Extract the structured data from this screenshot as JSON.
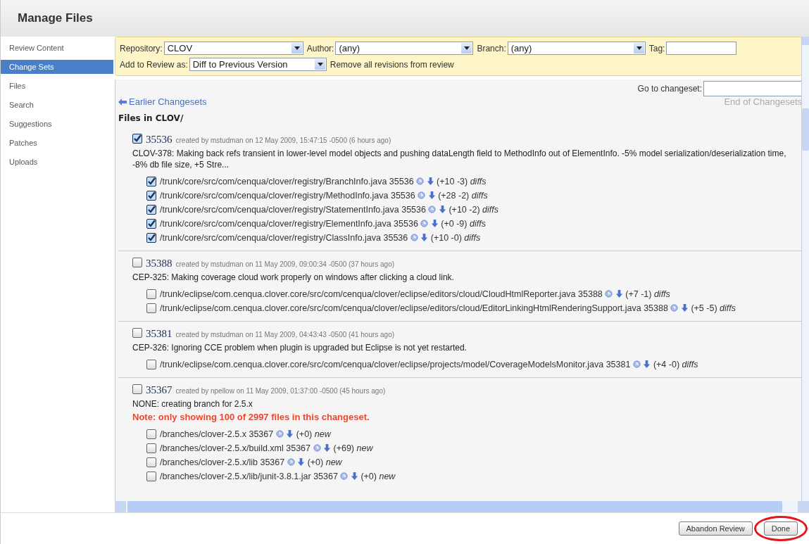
{
  "page": {
    "title": "Manage Files"
  },
  "sidebar": {
    "items": [
      {
        "label": "Review Content",
        "selected": false
      },
      {
        "label": "Change Sets",
        "selected": true
      },
      {
        "label": "Files",
        "selected": false
      },
      {
        "label": "Search",
        "selected": false
      },
      {
        "label": "Suggestions",
        "selected": false
      },
      {
        "label": "Patches",
        "selected": false
      },
      {
        "label": "Uploads",
        "selected": false
      }
    ]
  },
  "filters": {
    "repository_label": "Repository:",
    "repository": "CLOV",
    "author_label": "Author:",
    "author": "(any)",
    "branch_label": "Branch:",
    "branch": "(any)",
    "tag_label": "Tag:",
    "add_label": "Add to Review as:",
    "add_as": "Diff to Previous Version",
    "remove_link": "Remove all revisions from review"
  },
  "navigation": {
    "goto_label": "Go to changeset:",
    "earlier": "Earlier Changesets",
    "end": "End of Changesets"
  },
  "heading": "Files in CLOV/",
  "changesets": [
    {
      "checked": true,
      "revision": "35536",
      "meta": "created by mstudman on 12 May 2009, 15:47:15 -0500 (6 hours ago)",
      "description": "CLOV-378: Making back refs transient in lower-level model objects and pushing dataLength field to MethodInfo out of ElementInfo. -5% model serialization/deserialization time, -8% db file size, +5 Stre...",
      "files": [
        {
          "checked": true,
          "path": "/trunk/core/src/com/cenqua/clover/registry/BranchInfo.java",
          "revision": "35536",
          "changes": "(+10 -3)",
          "tag": "diffs"
        },
        {
          "checked": true,
          "path": "/trunk/core/src/com/cenqua/clover/registry/MethodInfo.java",
          "revision": "35536",
          "changes": "(+28 -2)",
          "tag": "diffs"
        },
        {
          "checked": true,
          "path": "/trunk/core/src/com/cenqua/clover/registry/StatementInfo.java",
          "revision": "35536",
          "changes": "(+10 -2)",
          "tag": "diffs"
        },
        {
          "checked": true,
          "path": "/trunk/core/src/com/cenqua/clover/registry/ElementInfo.java",
          "revision": "35536",
          "changes": "(+0 -9)",
          "tag": "diffs"
        },
        {
          "checked": true,
          "path": "/trunk/core/src/com/cenqua/clover/registry/ClassInfo.java",
          "revision": "35536",
          "changes": "(+10 -0)",
          "tag": "diffs"
        }
      ]
    },
    {
      "checked": false,
      "revision": "35388",
      "meta": "created by mstudman on 11 May 2009, 09:00:34 -0500 (37 hours ago)",
      "description": "CEP-325: Making coverage cloud work properly on windows after clicking a cloud link.",
      "files": [
        {
          "checked": false,
          "path": "/trunk/eclipse/com.cenqua.clover.core/src/com/cenqua/clover/eclipse/editors/cloud/CloudHtmlReporter.java",
          "revision": "35388",
          "changes": "(+7 -1)",
          "tag": "diffs"
        },
        {
          "checked": false,
          "path": "/trunk/eclipse/com.cenqua.clover.core/src/com/cenqua/clover/eclipse/editors/cloud/EditorLinkingHtmlRenderingSupport.java",
          "revision": "35388",
          "changes": "(+5 -5)",
          "tag": "diffs"
        }
      ]
    },
    {
      "checked": false,
      "revision": "35381",
      "meta": "created by mstudman on 11 May 2009, 04:43:43 -0500 (41 hours ago)",
      "description": "CEP-326: Ignoring CCE problem when plugin is upgraded but Eclipse is not yet restarted.",
      "files": [
        {
          "checked": false,
          "path": "/trunk/eclipse/com.cenqua.clover.core/src/com/cenqua/clover/eclipse/projects/model/CoverageModelsMonitor.java",
          "revision": "35381",
          "changes": "(+4 -0)",
          "tag": "diffs"
        }
      ]
    },
    {
      "checked": false,
      "revision": "35367",
      "meta": "created by npellow on 11 May 2009, 01:37:00 -0500 (45 hours ago)",
      "description": "NONE: creating branch for 2.5.x",
      "note": "Note: only showing 100 of 2997 files in this changeset.",
      "files": [
        {
          "checked": false,
          "path": "/branches/clover-2.5.x",
          "revision": "35367",
          "changes": "(+0)",
          "tag": "new"
        },
        {
          "checked": false,
          "path": "/branches/clover-2.5.x/build.xml",
          "revision": "35367",
          "changes": "(+69)",
          "tag": "new"
        },
        {
          "checked": false,
          "path": "/branches/clover-2.5.x/lib",
          "revision": "35367",
          "changes": "(+0)",
          "tag": "new"
        },
        {
          "checked": false,
          "path": "/branches/clover-2.5.x/lib/junit-3.8.1.jar",
          "revision": "35367",
          "changes": "(+0)",
          "tag": "new"
        }
      ]
    }
  ],
  "buttons": [
    {
      "label": "Abandon Review",
      "highlighted": false
    },
    {
      "label": "Done",
      "highlighted": true
    }
  ]
}
